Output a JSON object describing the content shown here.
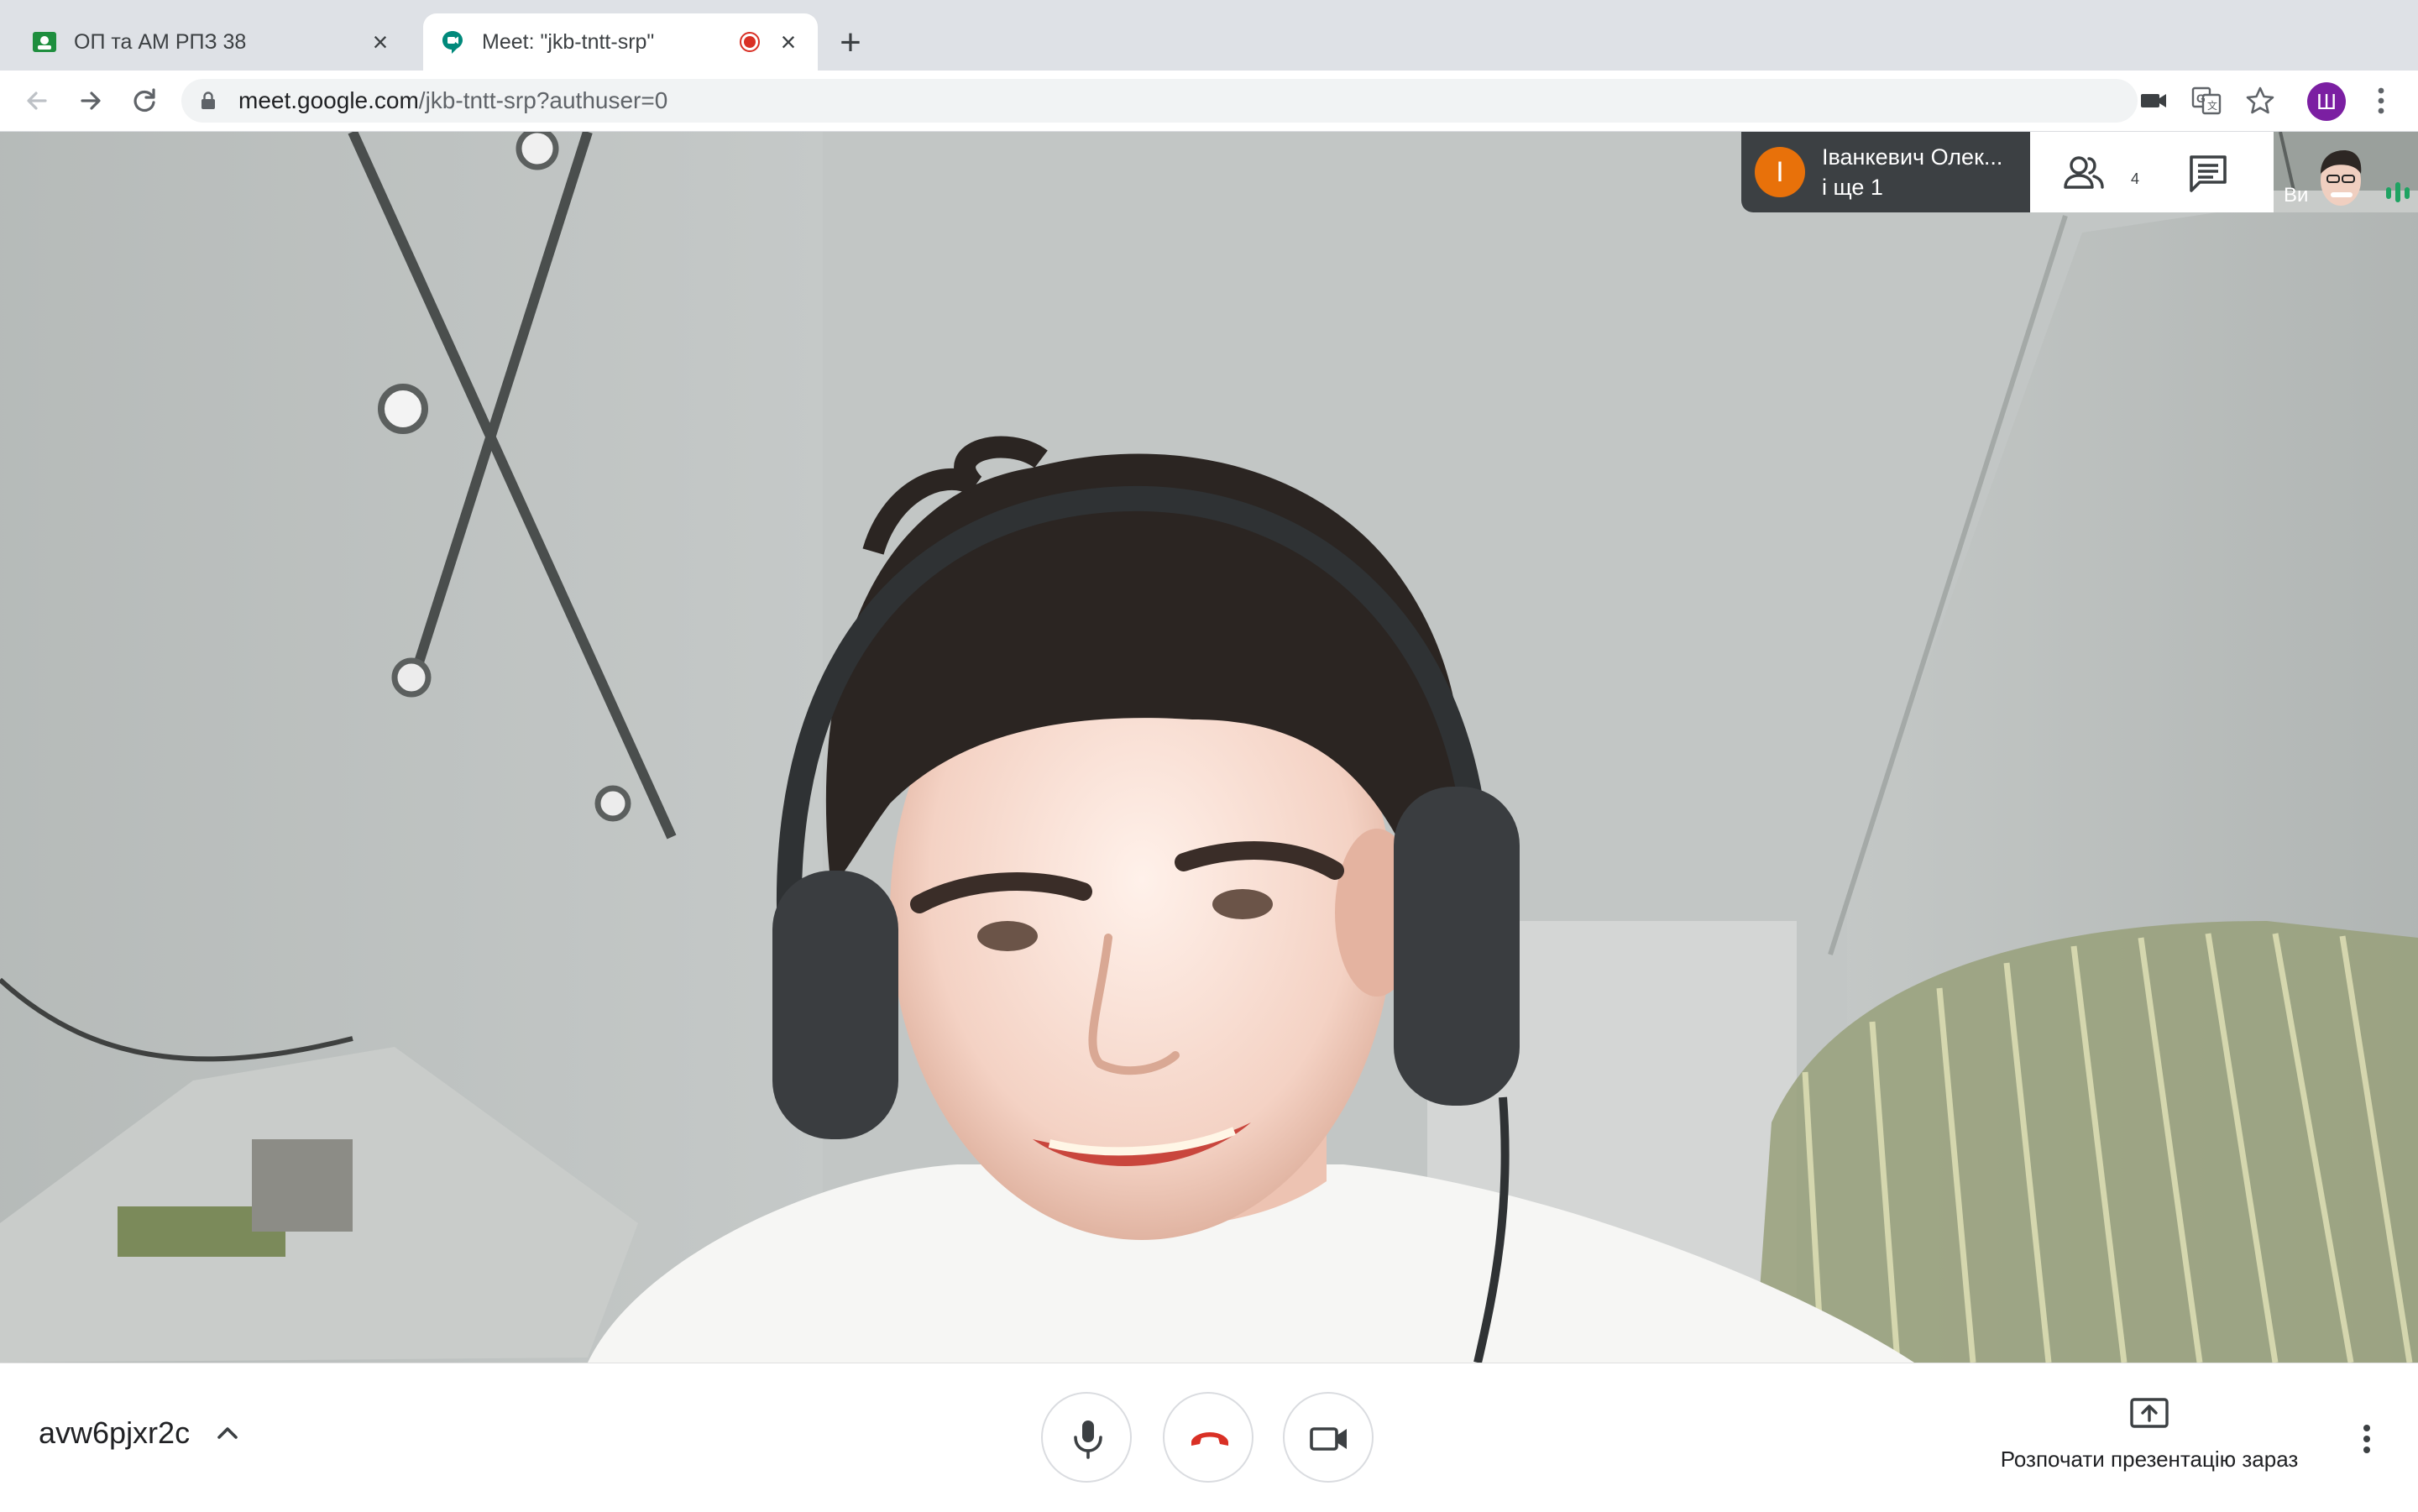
{
  "tabs": [
    {
      "title": "ОП та АМ РПЗ 38",
      "favicon": "classroom-icon",
      "close": "×"
    },
    {
      "title": "Meet: \"jkb-tntt-srp\"",
      "favicon": "meet-icon",
      "recording": true,
      "close": "×"
    }
  ],
  "new_tab_label": "+",
  "toolbar": {
    "url_host": "meet.google.com",
    "url_rest": "/jkb-tntt-srp?authuser=0",
    "profile_initial": "Ш"
  },
  "meet": {
    "participant_initial": "I",
    "participant_name": "Іванкевич Олек...",
    "participant_more": "і ще 1",
    "people_count": "4",
    "self_label": "Ви",
    "meeting_code": "avw6pjxr2c",
    "present_label": "Розпочати презентацію зараз"
  },
  "colors": {
    "hangup_red": "#d93025",
    "participant_orange": "#e8710a",
    "profile_purple": "#7b1fa2",
    "speaking_teal": "#1ea362"
  }
}
